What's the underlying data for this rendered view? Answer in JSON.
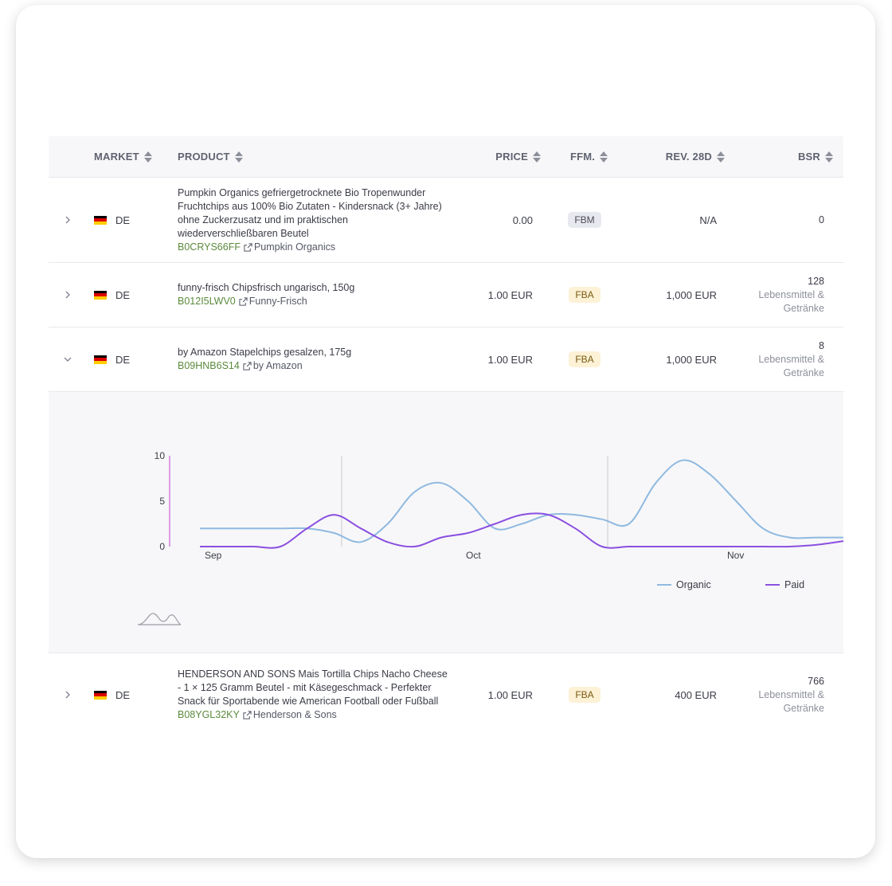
{
  "columns": {
    "market": "MARKET",
    "product": "PRODUCT",
    "price": "PRICE",
    "ffm": "FFM.",
    "rev": "REV. 28D",
    "bsr": "BSR"
  },
  "rows": [
    {
      "market": "DE",
      "title": "Pumpkin Organics gefriergetrocknete Bio Tropenwunder Fruchtchips aus 100% Bio Zutaten - Kindersnack (3+ Jahre) ohne Zuckerzusatz und im praktischen wiederverschließbaren Beutel",
      "asin": "B0CRYS66FF",
      "brand": "Pumpkin Organics",
      "price": "0.00",
      "ffm": "FBM",
      "rev": "N/A",
      "bsr": "0",
      "category": ""
    },
    {
      "market": "DE",
      "title": "funny-frisch Chipsfrisch ungarisch, 150g",
      "asin": "B012I5LWV0",
      "brand": "Funny-Frisch",
      "price": "1.00 EUR",
      "ffm": "FBA",
      "rev": "1,000 EUR",
      "bsr": "128",
      "category": "Lebensmittel & Getränke"
    },
    {
      "market": "DE",
      "title": "by Amazon Stapelchips gesalzen, 175g",
      "asin": "B09HNB6S14",
      "brand": "by Amazon",
      "price": "1.00 EUR",
      "ffm": "FBA",
      "rev": "1,000 EUR",
      "bsr": "8",
      "category": "Lebensmittel & Getränke"
    },
    {
      "market": "DE",
      "title": "HENDERSON AND SONS Mais Tortilla Chips Nacho Cheese - 1 × 125 Gramm Beutel - mit Käsegeschmack - Perfekter Snack für Sportabende wie American Football oder Fußball",
      "asin": "B08YGL32KY",
      "brand": "Henderson & Sons",
      "price": "1.00 EUR",
      "ffm": "FBA",
      "rev": "400 EUR",
      "bsr": "766",
      "category": "Lebensmittel & Getränke"
    }
  ],
  "icons": {
    "collapsed": "chevron-right-icon",
    "expanded": "chevron-down-icon",
    "flag": "de-flag-icon",
    "link": "external-link-icon",
    "sort": "sort-icon",
    "mini_chart": "sparkline-icon"
  },
  "colors": {
    "asin": "#5b8a3c",
    "fbm_badge": "#e8e9ee",
    "fba_badge": "#fdf1d6",
    "organic": "#8fb9e0",
    "paid": "#8a4fe0",
    "y_axis": "#d35fd8"
  },
  "chart_data": {
    "type": "line",
    "x_ticks": [
      "Sep",
      "Oct",
      "Nov"
    ],
    "y_ticks": [
      0,
      5,
      10
    ],
    "ylim": [
      0,
      10
    ],
    "legend_position": "bottom-right",
    "series": [
      {
        "name": "Organic",
        "color": "#8fb9e0",
        "values": [
          2,
          2,
          2,
          2,
          2,
          1.5,
          0.5,
          2.5,
          6,
          7,
          5,
          2,
          2.5,
          3.5,
          3.5,
          3,
          2.5,
          7,
          9.5,
          8,
          5,
          2,
          1,
          1,
          1
        ]
      },
      {
        "name": "Paid",
        "color": "#8a4fe0",
        "values": [
          0,
          0,
          0,
          0,
          2,
          3.5,
          2,
          0.5,
          0,
          1,
          1.5,
          2.5,
          3.5,
          3.5,
          2,
          0,
          0,
          0,
          0,
          0,
          0,
          0,
          0,
          0.2,
          0.6
        ]
      }
    ]
  }
}
